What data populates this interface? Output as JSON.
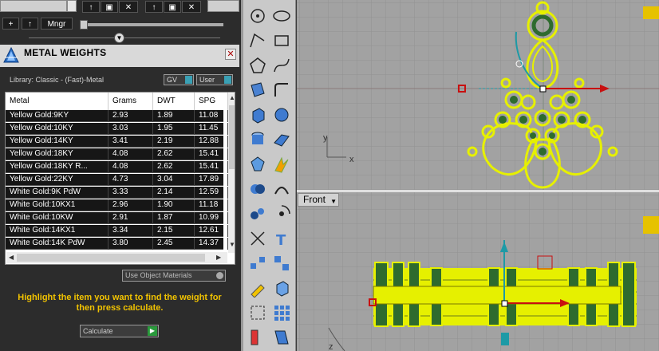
{
  "toolbar": {
    "row1_buttons": [
      "↑",
      "▣",
      "✕",
      "↑",
      "▣",
      "✕"
    ],
    "row2_buttons": [
      "+",
      "↑",
      "Mngr"
    ]
  },
  "metal_weights": {
    "title": "METAL WEIGHTS",
    "close": "✕",
    "library_label": "Library: Classic - (Fast)-Metal",
    "gv_select": "GV",
    "user_select": "User",
    "columns": [
      "Metal",
      "Grams",
      "DWT",
      "SPG"
    ],
    "rows": [
      [
        "Yellow Gold:9KY",
        "2.93",
        "1.89",
        "11.08"
      ],
      [
        "Yellow Gold:10KY",
        "3.03",
        "1.95",
        "11.45"
      ],
      [
        "Yellow Gold:14KY",
        "3.41",
        "2.19",
        "12.88"
      ],
      [
        "Yellow Gold:18KY",
        "4.08",
        "2.62",
        "15.41"
      ],
      [
        "Yellow Gold:18KY R...",
        "4.08",
        "2.62",
        "15.41"
      ],
      [
        "Yellow Gold:22KY",
        "4.73",
        "3.04",
        "17.89"
      ],
      [
        "White Gold:9K PdW",
        "3.33",
        "2.14",
        "12.59"
      ],
      [
        "White Gold:10KX1",
        "2.96",
        "1.90",
        "11.18"
      ],
      [
        "White Gold:10KW",
        "2.91",
        "1.87",
        "10.99"
      ],
      [
        "White Gold:14KX1",
        "3.34",
        "2.15",
        "12.61"
      ],
      [
        "White Gold:14K PdW",
        "3.80",
        "2.45",
        "14.37"
      ]
    ],
    "use_object_materials": "Use Object Materials",
    "hint": "Highlight the item you want to find the weight for then press calculate.",
    "calculate": "Calculate"
  },
  "viewports": {
    "front_label": "Front",
    "top_axis_x": "x",
    "top_axis_y": "y",
    "front_axis_z": "z"
  },
  "colors": {
    "geometry": "#e6f000",
    "geometry_dark": "#2e6b2e",
    "x_axis": "#c81010",
    "y_axis": "#1d9aa6"
  },
  "icons": [
    "circle-tool-icon",
    "ellipse-tool-icon",
    "polyline-icon",
    "rectangle-icon",
    "polygon-icon",
    "curve-icon",
    "surface-icon",
    "fillet-icon",
    "box-icon",
    "sphere-icon",
    "cylinder-icon",
    "plane-icon",
    "gem-icon",
    "bolt-icon",
    "boolean-icon",
    "shell-icon",
    "group-icon",
    "gumball-icon",
    "trim-icon",
    "text-icon",
    "array-icon",
    "mirror-icon",
    "pencil-icon",
    "render-icon",
    "scale-icon",
    "grid-icon",
    "dimension-icon",
    "layer-icon"
  ]
}
